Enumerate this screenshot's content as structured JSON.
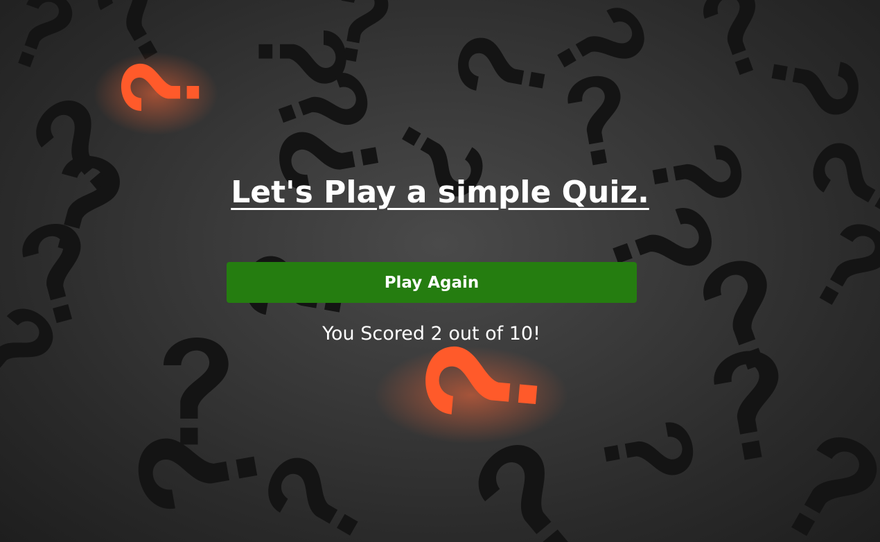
{
  "quiz": {
    "title": "Let's Play a simple Quiz.",
    "play_again_label": "Play Again",
    "score_text": "You Scored 2 out of 10!"
  },
  "background": {
    "description_icon": "question-mark-icon",
    "colors": {
      "dark": "#1e1e1e",
      "mid": "#3a3a3a",
      "accent": "#ff5a2a",
      "button": "#257d10"
    }
  }
}
